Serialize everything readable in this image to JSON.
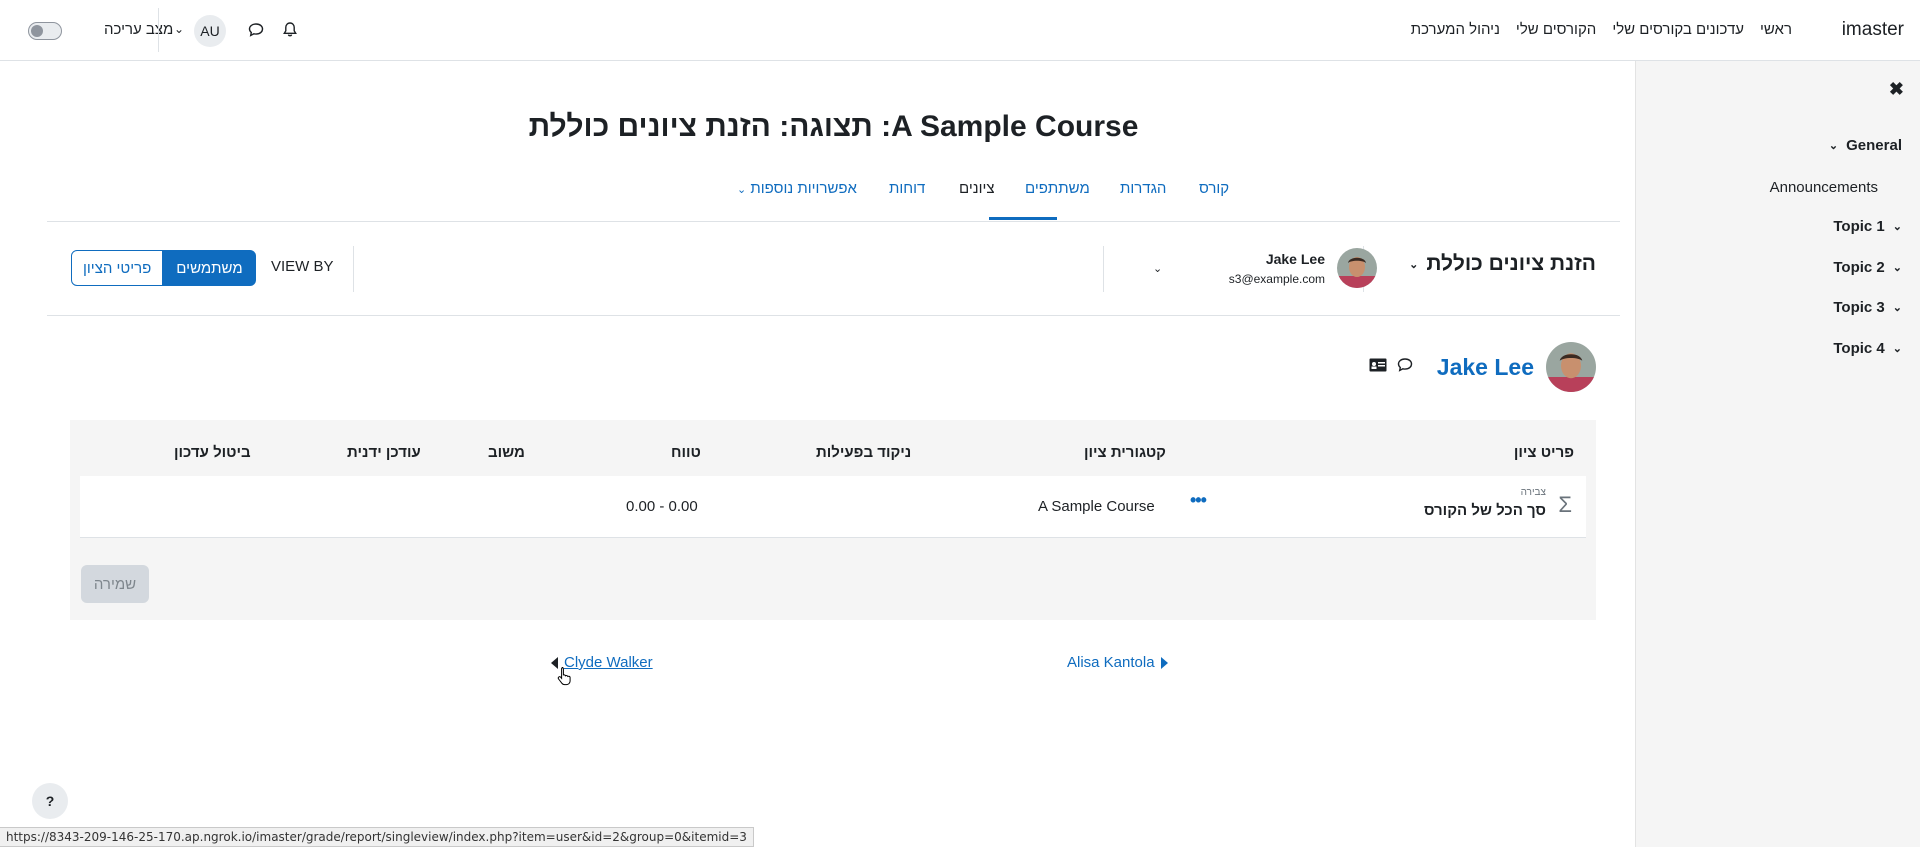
{
  "navbar": {
    "brand": "imaster",
    "primary_items": [
      "ראשי",
      "עדכונים בקורסים שלי",
      "הקורסים שלי",
      "ניהול המערכת"
    ],
    "edit_mode_label": "מצב עריכה",
    "user_initials": "AU"
  },
  "drawer": {
    "items": [
      {
        "label": "General"
      },
      {
        "label": "Announcements"
      },
      {
        "label": "Topic 1"
      },
      {
        "label": "Topic 2"
      },
      {
        "label": "Topic 3"
      },
      {
        "label": "Topic 4"
      }
    ]
  },
  "page": {
    "title": "A Sample Course: תצוגה: הזנת ציונים כוללת",
    "tabs": [
      "קורס",
      "הגדרות",
      "משתתפים",
      "ציונים",
      "דוחות",
      "אפשרויות נוספות"
    ],
    "active_tab": "ציונים"
  },
  "toolbar": {
    "report_select": "הזנת ציונים כוללת",
    "user_name": "Jake Lee",
    "user_email": "s3@example.com",
    "view_by_label": "VIEW BY",
    "view_users": "משתמשים",
    "view_grade_items": "פריטי הציון"
  },
  "user_heading": {
    "name": "Jake Lee"
  },
  "grade_table": {
    "headers": [
      "פריט ציון",
      "קטגורית ציון",
      "ניקוד בפעילות",
      "טווח",
      "משוב",
      "עודכן ידנית",
      "ביטול עדכון"
    ],
    "rows": [
      {
        "type_label": "צבירה",
        "item_name": "סך הכל של הקורס",
        "category": "A Sample Course",
        "range": "0.00 - 0.00"
      }
    ],
    "save_label": "שמירה"
  },
  "pager": {
    "next_user": "Alisa Kantola",
    "prev_user": "Clyde Walker"
  },
  "help_label": "?",
  "status_url": "https://8343-209-146-25-170.ap.ngrok.io/imaster/grade/report/singleview/index.php?item=user&id=2&group=0&itemid=3",
  "colors": {
    "primary": "#0f6cbf",
    "text": "#1d2125",
    "drawer_bg": "#f5f5f5"
  }
}
